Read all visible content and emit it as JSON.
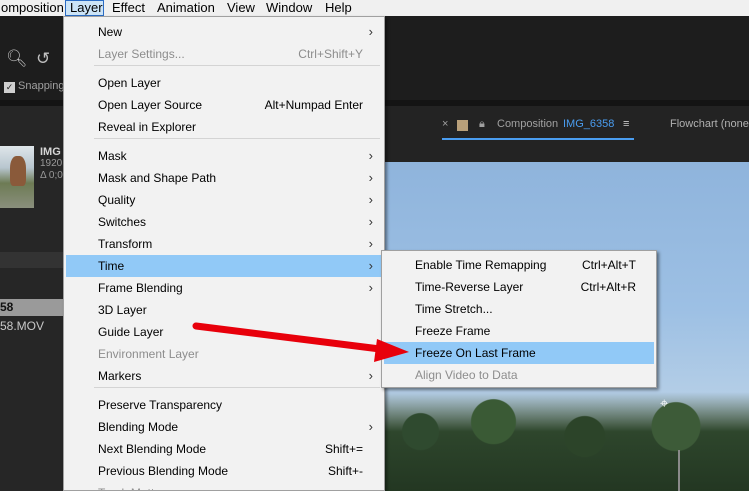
{
  "menubar": [
    "omposition",
    "Layer",
    "Effect",
    "Animation",
    "View",
    "Window",
    "Help"
  ],
  "toolbar": {
    "snapping_label": "Snapping"
  },
  "project": {
    "name": "IMG",
    "line1": "1920",
    "line2": "Δ 0;0",
    "selected": "58",
    "file": "58.MOV"
  },
  "comp_header": {
    "close": "×",
    "prefix": "Composition",
    "name": "IMG_6358",
    "menu": "≡",
    "flowchart": "Flowchart (none"
  },
  "layer_menu": [
    {
      "label": "New",
      "shortcut": "",
      "arrow": "›",
      "disabled": false
    },
    {
      "label": "Layer Settings...",
      "shortcut": "Ctrl+Shift+Y",
      "arrow": "",
      "disabled": true
    },
    {
      "label": "Open Layer",
      "shortcut": "",
      "arrow": "",
      "disabled": false
    },
    {
      "label": "Open Layer Source",
      "shortcut": "Alt+Numpad Enter",
      "arrow": "",
      "disabled": false
    },
    {
      "label": "Reveal in Explorer",
      "shortcut": "",
      "arrow": "",
      "disabled": false
    },
    {
      "label": "Mask",
      "shortcut": "",
      "arrow": "›",
      "disabled": false
    },
    {
      "label": "Mask and Shape Path",
      "shortcut": "",
      "arrow": "›",
      "disabled": false
    },
    {
      "label": "Quality",
      "shortcut": "",
      "arrow": "›",
      "disabled": false
    },
    {
      "label": "Switches",
      "shortcut": "",
      "arrow": "›",
      "disabled": false
    },
    {
      "label": "Transform",
      "shortcut": "",
      "arrow": "›",
      "disabled": false
    },
    {
      "label": "Time",
      "shortcut": "",
      "arrow": "›",
      "disabled": false,
      "highlighted": true
    },
    {
      "label": "Frame Blending",
      "shortcut": "",
      "arrow": "›",
      "disabled": false
    },
    {
      "label": "3D Layer",
      "shortcut": "",
      "arrow": "",
      "disabled": false
    },
    {
      "label": "Guide Layer",
      "shortcut": "",
      "arrow": "",
      "disabled": false
    },
    {
      "label": "Environment Layer",
      "shortcut": "",
      "arrow": "",
      "disabled": true
    },
    {
      "label": "Markers",
      "shortcut": "",
      "arrow": "›",
      "disabled": false
    },
    {
      "label": "Preserve Transparency",
      "shortcut": "",
      "arrow": "",
      "disabled": false
    },
    {
      "label": "Blending Mode",
      "shortcut": "",
      "arrow": "›",
      "disabled": false
    },
    {
      "label": "Next Blending Mode",
      "shortcut": "Shift+=",
      "arrow": "",
      "disabled": false
    },
    {
      "label": "Previous Blending Mode",
      "shortcut": "Shift+-",
      "arrow": "",
      "disabled": false
    },
    {
      "label": "Track Matte",
      "shortcut": "",
      "arrow": "›",
      "disabled": true
    }
  ],
  "time_submenu": [
    {
      "label": "Enable Time Remapping",
      "shortcut": "Ctrl+Alt+T",
      "disabled": false
    },
    {
      "label": "Time-Reverse Layer",
      "shortcut": "Ctrl+Alt+R",
      "disabled": false
    },
    {
      "label": "Time Stretch...",
      "shortcut": "",
      "disabled": false
    },
    {
      "label": "Freeze Frame",
      "shortcut": "",
      "disabled": false
    },
    {
      "label": "Freeze On Last Frame",
      "shortcut": "",
      "disabled": false,
      "highlighted": true
    },
    {
      "label": "Align Video to Data",
      "shortcut": "",
      "disabled": true
    }
  ],
  "colors": {
    "highlight": "#91c9f7",
    "annotation_arrow": "#e8000b",
    "comp_name": "#4a9df0"
  }
}
